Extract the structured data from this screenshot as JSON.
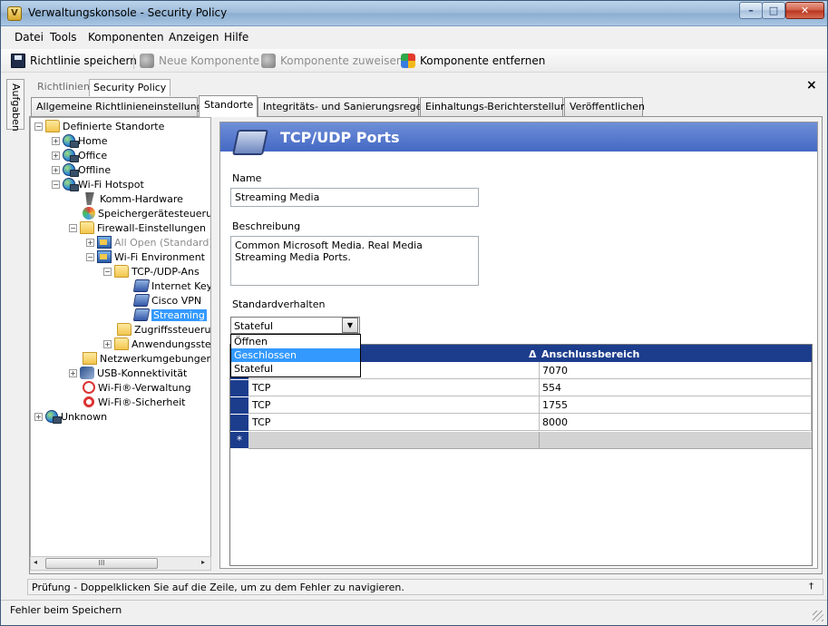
{
  "window": {
    "title": "Verwaltungskonsole - Security Policy",
    "icon_text": "V",
    "minimize": "–",
    "maximize": "□",
    "close": "✕"
  },
  "menu": [
    "Datei",
    "Tools",
    "Komponenten",
    "Anzeigen",
    "Hilfe"
  ],
  "toolbar": {
    "save": "Richtlinie speichern",
    "new_component": "Neue Komponente",
    "assign_component": "Komponente zuweisen",
    "remove_component": "Komponente entfernen"
  },
  "side_tab": "Aufgaben",
  "doc_tabs": {
    "inactive": "Richtlinien",
    "active": "Security Policy",
    "close": "×"
  },
  "policy_tabs": [
    "Allgemeine Richtlinieneinstellungen",
    "Standorte",
    "Integritäts- und Sanierungsregeln",
    "Einhaltungs-Berichterstellung",
    "Veröffentlichen"
  ],
  "tree": [
    {
      "label": "Definierte Standorte",
      "icon": "folder-open-icon",
      "expander": "−"
    },
    {
      "label": "Home",
      "icon": "globe-icon",
      "expander": "+"
    },
    {
      "label": "Office",
      "icon": "globe-icon",
      "expander": "+"
    },
    {
      "label": "Offline",
      "icon": "globe-icon",
      "expander": "+"
    },
    {
      "label": "Wi-Fi Hotspot",
      "icon": "globe-icon",
      "expander": "−"
    },
    {
      "label": "Komm-Hardware",
      "icon": "hardware-icon",
      "expander": ""
    },
    {
      "label": "Speichergerätesteuerun",
      "icon": "storage-icon",
      "expander": ""
    },
    {
      "label": "Firewall-Einstellungen",
      "icon": "folder-open-icon",
      "expander": "−"
    },
    {
      "label": "All Open (Standard)",
      "icon": "firewall-icon",
      "expander": "+"
    },
    {
      "label": "Wi-Fi Environment",
      "icon": "firewall-icon",
      "expander": "−"
    },
    {
      "label": "TCP-/UDP-Ans",
      "icon": "folder-open-icon",
      "expander": "−"
    },
    {
      "label": "Internet Key",
      "icon": "port-icon",
      "expander": ""
    },
    {
      "label": "Cisco VPN",
      "icon": "port-icon",
      "expander": ""
    },
    {
      "label": "Streaming",
      "icon": "port-icon",
      "expander": ""
    },
    {
      "label": "Zugriffssteuerun",
      "icon": "folder-icon",
      "expander": ""
    },
    {
      "label": "Anwendungsste",
      "icon": "folder-icon",
      "expander": "+"
    },
    {
      "label": "Netzwerkumgebungen",
      "icon": "network-folder-icon",
      "expander": ""
    },
    {
      "label": "USB-Konnektivität",
      "icon": "usb-icon",
      "expander": "+"
    },
    {
      "label": "Wi-Fi®-Verwaltung",
      "icon": "wifi-icon",
      "expander": ""
    },
    {
      "label": "Wi-Fi®-Sicherheit",
      "icon": "wifi-security-icon",
      "expander": ""
    },
    {
      "label": "Unknown",
      "icon": "globe-icon",
      "expander": "+"
    }
  ],
  "tree_scroll": {
    "left": "◂",
    "right": "▸",
    "thumb": "III"
  },
  "detail": {
    "title": "TCP/UDP Ports",
    "name_label": "Name",
    "name_value": "Streaming Media",
    "desc_label": "Beschreibung",
    "desc_value": "Common Microsoft Media. Real Media Streaming Media Ports.",
    "default_label": "Standardverhalten",
    "default_value": "Stateful",
    "combo_arrow": "▼",
    "options": [
      "Öffnen",
      "Geschlossen",
      "Stateful"
    ],
    "highlighted_option": "Geschlossen"
  },
  "grid": {
    "sort_indicator": "Δ",
    "columns": [
      "",
      "Anschlussbereich"
    ],
    "rows": [
      {
        "protocol": "",
        "range": "7070"
      },
      {
        "protocol": "TCP",
        "range": "554"
      },
      {
        "protocol": "TCP",
        "range": "1755"
      },
      {
        "protocol": "TCP",
        "range": "8000"
      }
    ],
    "new_row_marker": "*"
  },
  "error_bar": "Prüfung - Doppelklicken Sie auf die Zeile, um zu dem Fehler zu navigieren.",
  "pin": "†",
  "status": "Fehler beim Speichern",
  "colors": {
    "header_blue": "#4468c4",
    "grid_header": "#1c3d8c",
    "selection": "#3399ff"
  }
}
